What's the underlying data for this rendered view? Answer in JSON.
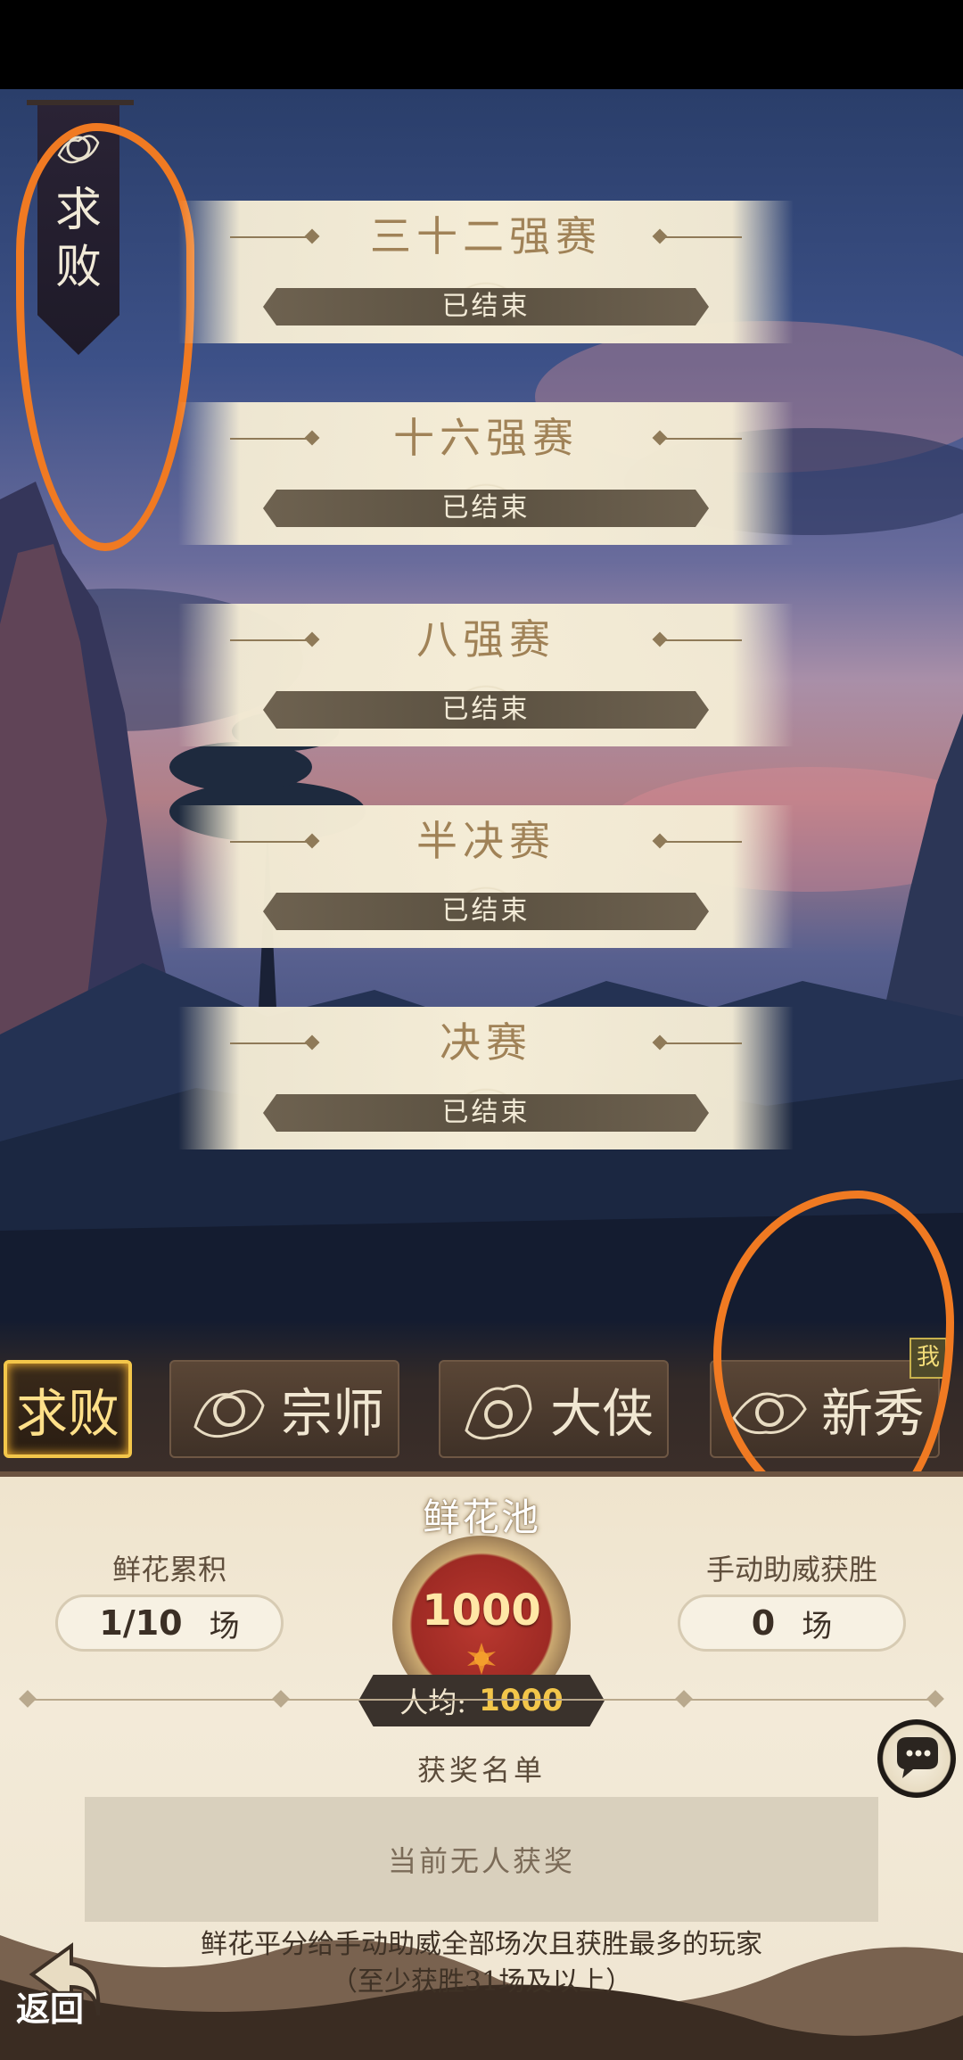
{
  "banner": {
    "label": "求\n败",
    "icon": "dragon-emblem-icon"
  },
  "stages": [
    {
      "title": "三十二强赛",
      "status": "已结束"
    },
    {
      "title": "十六强赛",
      "status": "已结束"
    },
    {
      "title": "八强赛",
      "status": "已结束"
    },
    {
      "title": "半决赛",
      "status": "已结束"
    },
    {
      "title": "决赛",
      "status": "已结束"
    }
  ],
  "tabs": [
    {
      "label": "求败",
      "active": true
    },
    {
      "label": "宗师",
      "icon": "tiger-emblem-icon"
    },
    {
      "label": "大侠",
      "icon": "dragon-emblem-icon"
    },
    {
      "label": "新秀",
      "icon": "phoenix-emblem-icon",
      "badge": "我"
    }
  ],
  "panel": {
    "left_stat": {
      "label": "鲜花累积",
      "value": "1/10",
      "unit": "场"
    },
    "right_stat": {
      "label": "手动助威获胜",
      "value": "0",
      "unit": "场"
    },
    "pool": {
      "title": "鲜花池",
      "value": "1000",
      "avg_label": "人均:",
      "avg_value": "1000"
    },
    "winners": {
      "title": "获奖名单",
      "empty_text": "当前无人获奖"
    },
    "footer_text": "鲜花平分给手动助威全部场次且获胜最多的玩家（至少获胜31场及以上）",
    "back_label": "返回"
  },
  "colors": {
    "annotation": "#f07a22",
    "active_tab_border": "#f3c64a",
    "stage_title": "#a08257"
  }
}
